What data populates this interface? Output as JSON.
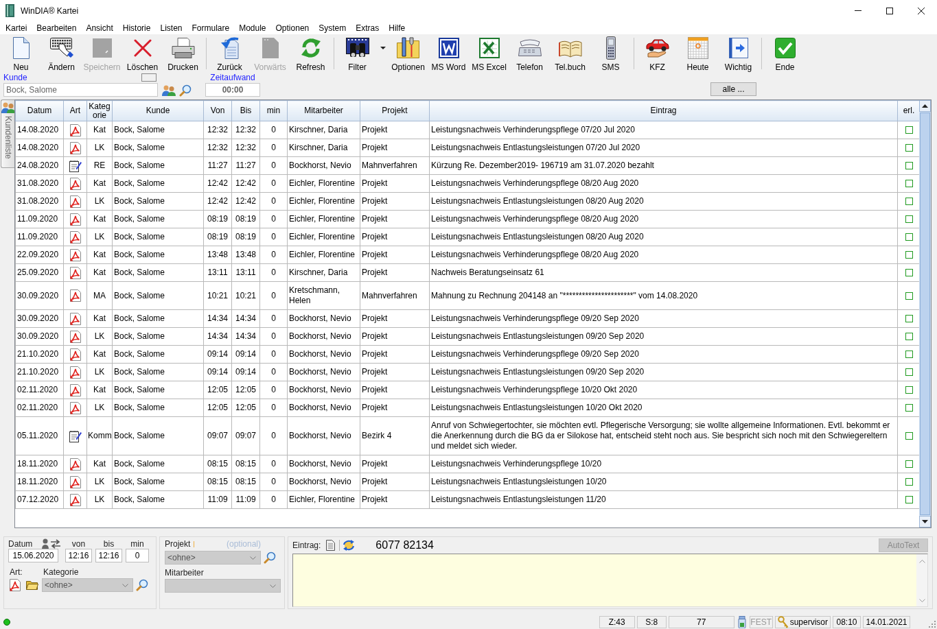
{
  "window": {
    "title": "WinDIA® Kartei"
  },
  "menu": [
    "Kartei",
    "Bearbeiten",
    "Ansicht",
    "Historie",
    "Listen",
    "Formulare",
    "Module",
    "Optionen",
    "System",
    "Extras",
    "Hilfe"
  ],
  "toolbar": {
    "groups": [
      {
        "items": [
          {
            "label": "Neu",
            "kind": "button",
            "disabled": false
          },
          {
            "label": "Ändern",
            "kind": "button",
            "disabled": false
          },
          {
            "label": "Speichern",
            "kind": "button",
            "disabled": true
          },
          {
            "label": "Löschen",
            "kind": "button",
            "disabled": false
          },
          {
            "label": "Drucken",
            "kind": "button",
            "disabled": false
          }
        ]
      },
      {
        "items": [
          {
            "label": "Zurück",
            "kind": "button",
            "disabled": false
          },
          {
            "label": "Vorwärts",
            "kind": "button",
            "disabled": true
          },
          {
            "label": "Refresh",
            "kind": "button",
            "disabled": false
          }
        ]
      },
      {
        "items": [
          {
            "label": "Filter",
            "kind": "split",
            "disabled": false
          },
          {
            "label": "Optionen",
            "kind": "button",
            "disabled": false
          },
          {
            "label": "MS Word",
            "kind": "button",
            "disabled": false
          },
          {
            "label": "MS Excel",
            "kind": "button",
            "disabled": false
          },
          {
            "label": "Telefon",
            "kind": "button",
            "disabled": false
          },
          {
            "label": "Tel.buch",
            "kind": "button",
            "disabled": false
          },
          {
            "label": "SMS",
            "kind": "button",
            "disabled": false
          }
        ]
      },
      {
        "items": [
          {
            "label": "KFZ",
            "kind": "button",
            "disabled": false
          },
          {
            "label": "Heute",
            "kind": "button",
            "disabled": false
          },
          {
            "label": "Wichtig",
            "kind": "button",
            "disabled": false
          }
        ]
      },
      {
        "items": [
          {
            "label": "Ende",
            "kind": "button",
            "disabled": false
          }
        ]
      }
    ]
  },
  "customer": {
    "label": "Kunde",
    "value": "Bock, Salome"
  },
  "time_spent": {
    "label": "Zeitaufwand",
    "value": "00:00"
  },
  "show_all_button": "alle ...",
  "side_tab": {
    "label": "Kundenliste"
  },
  "table": {
    "columns": [
      "Datum",
      "Art",
      "Kategorie",
      "Kunde",
      "Von",
      "Bis",
      "min",
      "Mitarbeiter",
      "Projekt",
      "Eintrag",
      "erl."
    ],
    "rows": [
      {
        "datum": "14.08.2020",
        "kind": "pdf",
        "kategorie": "Kat",
        "kunde": "Bock, Salome",
        "von": "12:32",
        "bis": "12:32",
        "min": "0",
        "mitarbeiter": "Kirschner, Daria",
        "projekt": "Projekt",
        "eintrag": "Leistungsnachweis Verhinderungspflege 07/20 Jul 2020",
        "done": false
      },
      {
        "datum": "14.08.2020",
        "kind": "pdf",
        "kategorie": "LK",
        "kunde": "Bock, Salome",
        "von": "12:32",
        "bis": "12:32",
        "min": "0",
        "mitarbeiter": "Kirschner, Daria",
        "projekt": "Projekt",
        "eintrag": "Leistungsnachweis Entlastungsleistungen 07/20 Jul 2020",
        "done": false
      },
      {
        "datum": "24.08.2020",
        "kind": "note",
        "kategorie": "RE",
        "kunde": "Bock, Salome",
        "von": "11:27",
        "bis": "11:27",
        "min": "0",
        "mitarbeiter": "Bockhorst, Nevio",
        "projekt": "Mahnverfahren",
        "eintrag": "Kürzung Re. Dezember2019- 196719 am 31.07.2020 bezahlt",
        "done": false
      },
      {
        "datum": "31.08.2020",
        "kind": "pdf",
        "kategorie": "Kat",
        "kunde": "Bock, Salome",
        "von": "12:42",
        "bis": "12:42",
        "min": "0",
        "mitarbeiter": "Eichler, Florentine",
        "projekt": "Projekt",
        "eintrag": "Leistungsnachweis Verhinderungspflege 08/20 Aug 2020",
        "done": false
      },
      {
        "datum": "31.08.2020",
        "kind": "pdf",
        "kategorie": "LK",
        "kunde": "Bock, Salome",
        "von": "12:42",
        "bis": "12:42",
        "min": "0",
        "mitarbeiter": "Eichler, Florentine",
        "projekt": "Projekt",
        "eintrag": "Leistungsnachweis Entlastungsleistungen 08/20 Aug 2020",
        "done": false
      },
      {
        "datum": "11.09.2020",
        "kind": "pdf",
        "kategorie": "Kat",
        "kunde": "Bock, Salome",
        "von": "08:19",
        "bis": "08:19",
        "min": "0",
        "mitarbeiter": "Eichler, Florentine",
        "projekt": "Projekt",
        "eintrag": "Leistungsnachweis Verhinderungspflege 08/20 Aug 2020",
        "done": false
      },
      {
        "datum": "11.09.2020",
        "kind": "pdf",
        "kategorie": "LK",
        "kunde": "Bock, Salome",
        "von": "08:19",
        "bis": "08:19",
        "min": "0",
        "mitarbeiter": "Eichler, Florentine",
        "projekt": "Projekt",
        "eintrag": "Leistungsnachweis Entlastungsleistungen 08/20 Aug 2020",
        "done": false
      },
      {
        "datum": "22.09.2020",
        "kind": "pdf",
        "kategorie": "Kat",
        "kunde": "Bock, Salome",
        "von": "13:48",
        "bis": "13:48",
        "min": "0",
        "mitarbeiter": "Eichler, Florentine",
        "projekt": "Projekt",
        "eintrag": "Leistungsnachweis Verhinderungspflege 08/20 Aug 2020",
        "done": false
      },
      {
        "datum": "25.09.2020",
        "kind": "pdf",
        "kategorie": "Kat",
        "kunde": "Bock, Salome",
        "von": "13:11",
        "bis": "13:11",
        "min": "0",
        "mitarbeiter": "Kirschner, Daria",
        "projekt": "Projekt",
        "eintrag": "Nachweis Beratungseinsatz 61",
        "done": false
      },
      {
        "datum": "30.09.2020",
        "kind": "pdf",
        "kategorie": "MA",
        "kunde": "Bock, Salome",
        "von": "10:21",
        "bis": "10:21",
        "min": "0",
        "mitarbeiter": "Kretschmann, Helen",
        "projekt": "Mahnverfahren",
        "eintrag": "Mahnung zu Rechnung 204148 an \"**********************\" vom 14.08.2020",
        "done": false
      },
      {
        "datum": "30.09.2020",
        "kind": "pdf",
        "kategorie": "Kat",
        "kunde": "Bock, Salome",
        "von": "14:34",
        "bis": "14:34",
        "min": "0",
        "mitarbeiter": "Bockhorst, Nevio",
        "projekt": "Projekt",
        "eintrag": "Leistungsnachweis Verhinderungspflege 09/20 Sep 2020",
        "done": false
      },
      {
        "datum": "30.09.2020",
        "kind": "pdf",
        "kategorie": "LK",
        "kunde": "Bock, Salome",
        "von": "14:34",
        "bis": "14:34",
        "min": "0",
        "mitarbeiter": "Bockhorst, Nevio",
        "projekt": "Projekt",
        "eintrag": "Leistungsnachweis Entlastungsleistungen 09/20 Sep 2020",
        "done": false
      },
      {
        "datum": "21.10.2020",
        "kind": "pdf",
        "kategorie": "Kat",
        "kunde": "Bock, Salome",
        "von": "09:14",
        "bis": "09:14",
        "min": "0",
        "mitarbeiter": "Bockhorst, Nevio",
        "projekt": "Projekt",
        "eintrag": "Leistungsnachweis Verhinderungspflege 09/20 Sep 2020",
        "done": false
      },
      {
        "datum": "21.10.2020",
        "kind": "pdf",
        "kategorie": "LK",
        "kunde": "Bock, Salome",
        "von": "09:14",
        "bis": "09:14",
        "min": "0",
        "mitarbeiter": "Bockhorst, Nevio",
        "projekt": "Projekt",
        "eintrag": "Leistungsnachweis Entlastungsleistungen 09/20 Sep 2020",
        "done": false
      },
      {
        "datum": "02.11.2020",
        "kind": "pdf",
        "kategorie": "Kat",
        "kunde": "Bock, Salome",
        "von": "12:05",
        "bis": "12:05",
        "min": "0",
        "mitarbeiter": "Bockhorst, Nevio",
        "projekt": "Projekt",
        "eintrag": "Leistungsnachweis Verhinderungspflege 10/20 Okt 2020",
        "done": false
      },
      {
        "datum": "02.11.2020",
        "kind": "pdf",
        "kategorie": "LK",
        "kunde": "Bock, Salome",
        "von": "12:05",
        "bis": "12:05",
        "min": "0",
        "mitarbeiter": "Bockhorst, Nevio",
        "projekt": "Projekt",
        "eintrag": "Leistungsnachweis Entlastungsleistungen 10/20 Okt 2020",
        "done": false
      },
      {
        "datum": "05.11.2020",
        "kind": "note",
        "kategorie": "Komm",
        "kunde": "Bock, Salome",
        "von": "09:07",
        "bis": "09:07",
        "min": "0",
        "mitarbeiter": "Bockhorst, Nevio",
        "projekt": "Bezirk 4",
        "eintrag": "Anruf von Schwiegertochter, sie möchten evtl. Pflegerische Versorgung; sie wollte allgemeine Informationen. Evtl. bekommt er die Anerkennung durch die BG da er Silokose hat, entscheid steht noch aus. Sie bespricht sich noch mit den Schwiegereltern und meldet sich wieder.",
        "done": false
      },
      {
        "datum": "18.11.2020",
        "kind": "pdf",
        "kategorie": "Kat",
        "kunde": "Bock, Salome",
        "von": "08:15",
        "bis": "08:15",
        "min": "0",
        "mitarbeiter": "Bockhorst, Nevio",
        "projekt": "Projekt",
        "eintrag": "Leistungsnachweis Verhinderungspflege 10/20",
        "done": false
      },
      {
        "datum": "18.11.2020",
        "kind": "pdf",
        "kategorie": "LK",
        "kunde": "Bock, Salome",
        "von": "08:15",
        "bis": "08:15",
        "min": "0",
        "mitarbeiter": "Bockhorst, Nevio",
        "projekt": "Projekt",
        "eintrag": "Leistungsnachweis Entlastungsleistungen 10/20",
        "done": false
      },
      {
        "datum": "07.12.2020",
        "kind": "pdf",
        "kategorie": "LK",
        "kunde": "Bock, Salome",
        "von": "11:09",
        "bis": "11:09",
        "min": "0",
        "mitarbeiter": "Eichler, Florentine",
        "projekt": "Projekt",
        "eintrag": "Leistungsnachweis Entlastungsleistungen 11/20",
        "done": false
      }
    ]
  },
  "entry_form": {
    "datum": {
      "label": "Datum",
      "value": "15.06.2020"
    },
    "von": {
      "label": "von",
      "value": "12:16"
    },
    "bis": {
      "label": "bis",
      "value": "12:16"
    },
    "min": {
      "label": "min",
      "value": "0"
    },
    "art": {
      "label": "Art:"
    },
    "kategorie": {
      "label": "Kategorie",
      "value": "<ohne>",
      "disabled": true
    },
    "projekt": {
      "label": "Projekt",
      "note": "(optional)",
      "value": "<ohne>",
      "disabled": true
    },
    "mitarbeiter": {
      "label": "Mitarbeiter",
      "disabled": true
    },
    "eintrag": {
      "label": "Eintrag:",
      "phone": "6077 82134"
    },
    "autotext_button": {
      "label": "AutoText",
      "disabled": true
    }
  },
  "status_bar": {
    "fields": [
      "Z:43",
      "S:8",
      "77"
    ],
    "fest": {
      "label": "FEST",
      "on": false
    },
    "user": "supervisor",
    "time": "08:10",
    "date": "14.01.2021"
  }
}
